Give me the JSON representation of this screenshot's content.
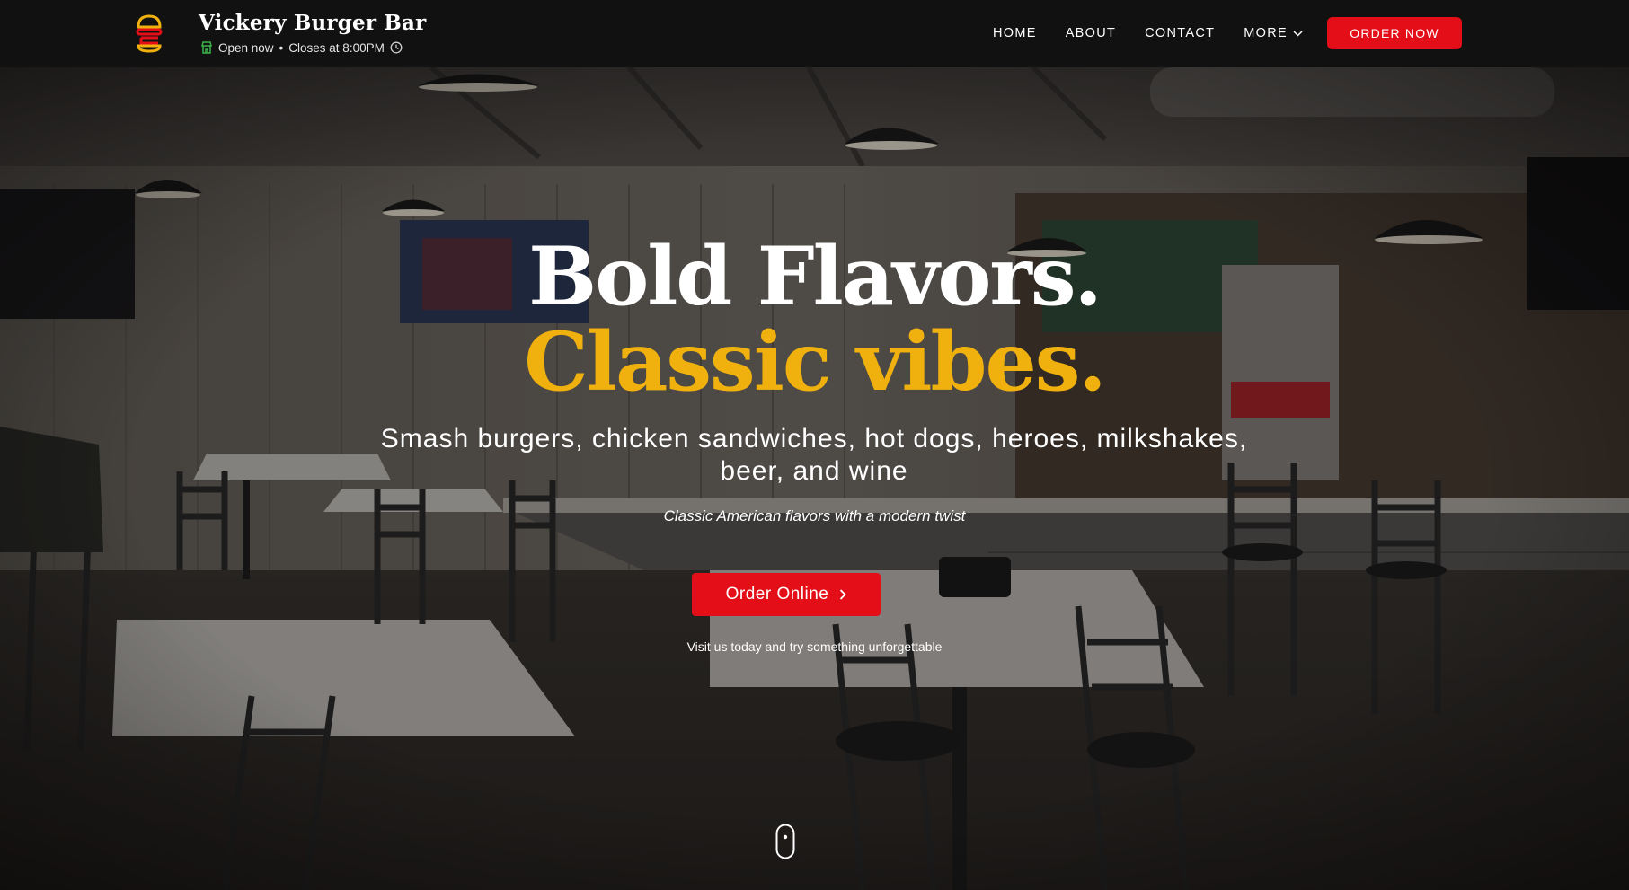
{
  "header": {
    "brand_name": "Vickery Burger Bar",
    "status_open": "Open now",
    "status_separator": "•",
    "status_closes": "Closes at 8:00PM",
    "nav": {
      "home": "HOME",
      "about": "ABOUT",
      "contact": "CONTACT",
      "more": "MORE"
    },
    "order_button": "ORDER NOW"
  },
  "hero": {
    "headline_line1": "Bold Flavors.",
    "headline_line2": "Classic vibes.",
    "subheadline": "Smash burgers, chicken sandwiches, hot dogs, heroes, milkshakes, beer, and wine",
    "tagline": "Classic American flavors with a modern twist",
    "cta_label": "Order Online",
    "visit_text": "Visit us today and try something unforgettable"
  },
  "colors": {
    "nav_background": "#111111",
    "accent_red": "#e30e17",
    "accent_gold": "#f0b10f",
    "open_status_green": "#3bb54a"
  },
  "icons": {
    "logo": "burger-logo-icon",
    "status": "store-icon",
    "hours": "clock-icon",
    "more": "chevron-down-icon",
    "cta": "chevron-right-icon",
    "scroll": "mouse-scroll-icon"
  }
}
